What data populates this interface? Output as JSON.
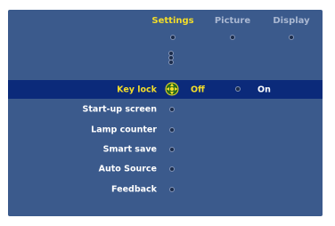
{
  "tabs": [
    {
      "label": "Settings",
      "active": true
    },
    {
      "label": "Picture",
      "active": false
    },
    {
      "label": "Display",
      "active": false
    }
  ],
  "menu": {
    "items": [
      {
        "label": "Key lock",
        "selected": true
      },
      {
        "label": "Start-up screen"
      },
      {
        "label": "Lamp counter"
      },
      {
        "label": "Smart save"
      },
      {
        "label": "Auto Source"
      },
      {
        "label": "Feedback"
      }
    ]
  },
  "key_lock": {
    "options": [
      "Off",
      "On"
    ],
    "selected": "Off"
  },
  "icons": {
    "selector": "navigation-cross-icon",
    "scroll": "scroll-up-indicator-icon"
  },
  "colors": {
    "panel": "#3b5a8c",
    "highlight": "#0b2a7a",
    "active_tab": "#f2dc2a",
    "inactive_tab": "#aab8d2"
  }
}
